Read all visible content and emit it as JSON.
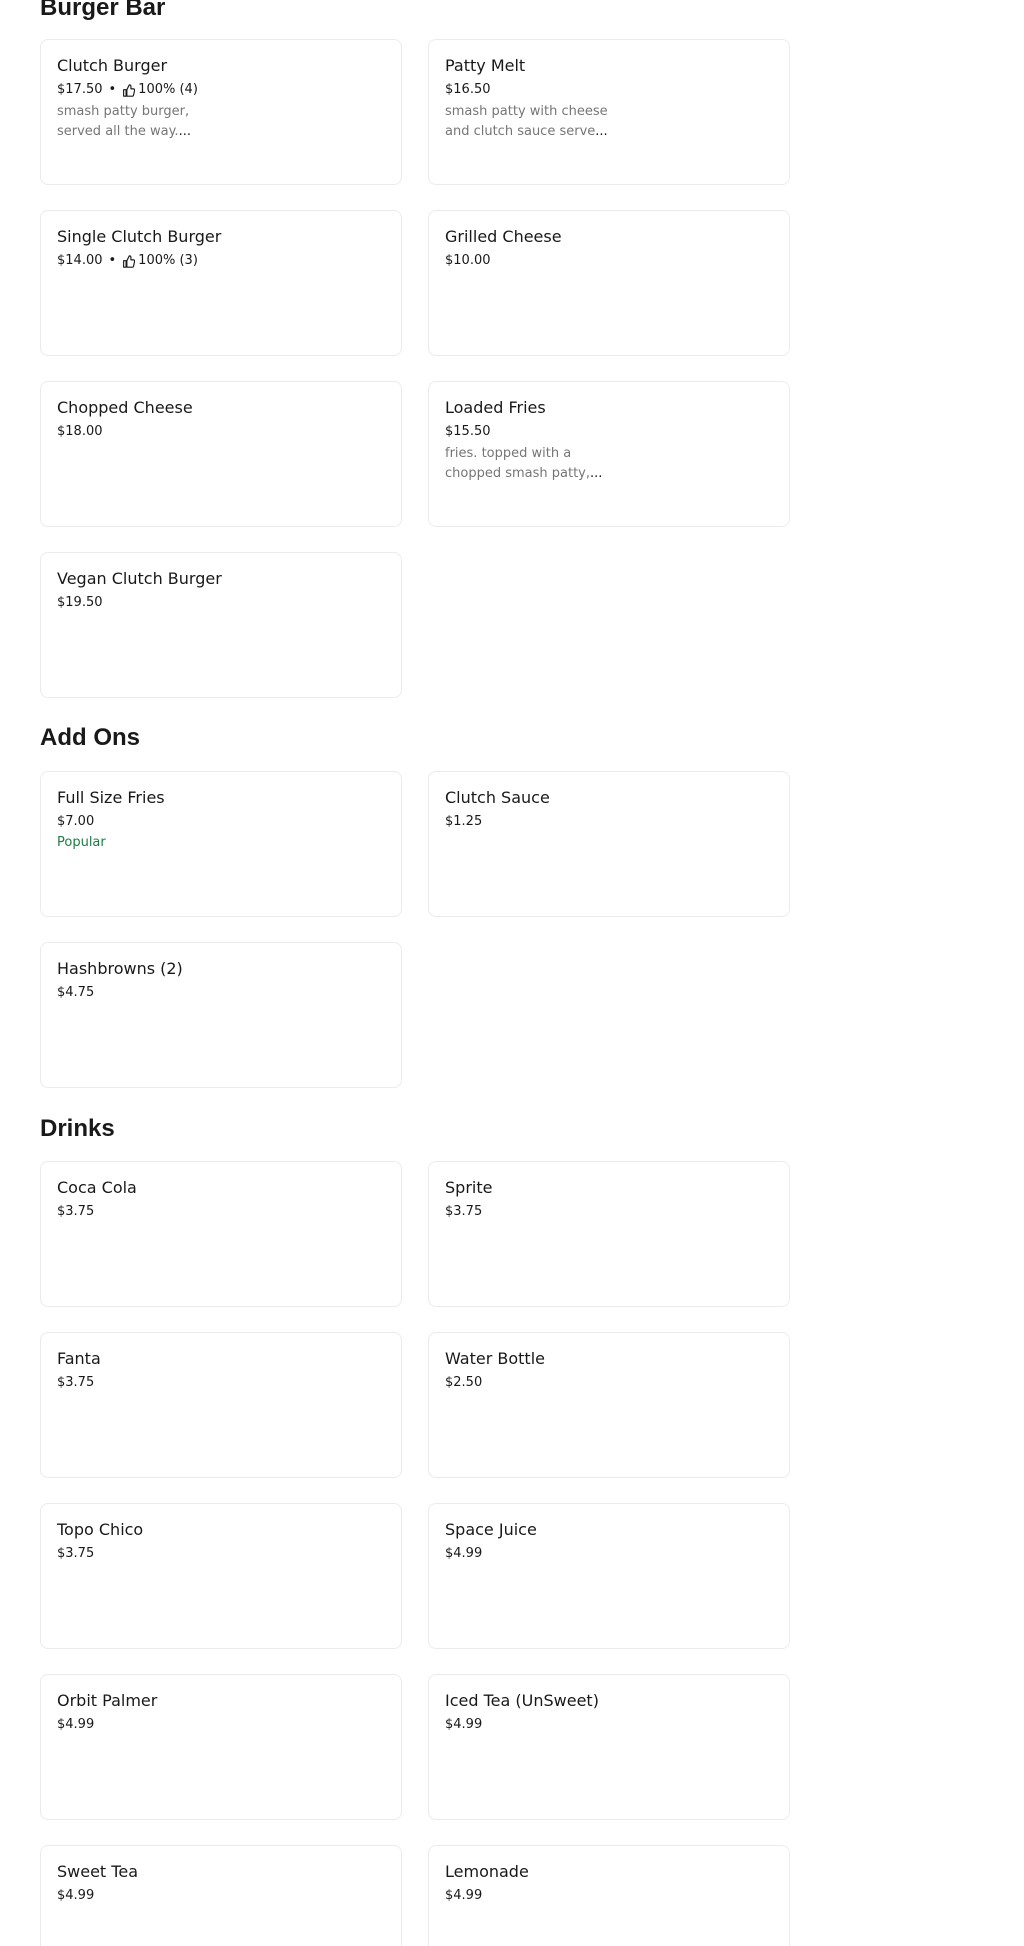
{
  "sections": [
    {
      "title": "Burger Bar",
      "items": [
        {
          "name": "Clutch Burger",
          "price": "$17.50",
          "rating": "100% (4)",
          "description_line1": "smash patty burger,",
          "description_line2": "served all the way.",
          "ellipsis": "..."
        },
        {
          "name": "Patty Melt",
          "price": "$16.50",
          "description_line1": "smash patty with cheese",
          "description_line2": "and clutch sauce serve",
          "ellipsis": "..."
        },
        {
          "name": "Single Clutch Burger",
          "price": "$14.00",
          "rating": "100% (3)"
        },
        {
          "name": "Grilled Cheese",
          "price": "$10.00"
        },
        {
          "name": "Chopped Cheese",
          "price": "$18.00"
        },
        {
          "name": "Loaded Fries",
          "price": "$15.50",
          "description_line1": "fries. topped with a",
          "description_line2": "chopped smash patty,",
          "ellipsis": "..."
        },
        {
          "name": "Vegan Clutch Burger",
          "price": "$19.50"
        }
      ]
    },
    {
      "title": "Add Ons",
      "items": [
        {
          "name": "Full Size Fries",
          "price": "$7.00",
          "badge": "Popular"
        },
        {
          "name": "Clutch Sauce",
          "price": "$1.25"
        },
        {
          "name": "Hashbrowns (2)",
          "price": "$4.75"
        }
      ]
    },
    {
      "title": "Drinks",
      "items": [
        {
          "name": "Coca Cola",
          "price": "$3.75"
        },
        {
          "name": "Sprite",
          "price": "$3.75"
        },
        {
          "name": "Fanta",
          "price": "$3.75"
        },
        {
          "name": "Water Bottle",
          "price": "$2.50"
        },
        {
          "name": "Topo Chico",
          "price": "$3.75"
        },
        {
          "name": "Space Juice",
          "price": "$4.99"
        },
        {
          "name": "Orbit Palmer",
          "price": "$4.99"
        },
        {
          "name": "Iced Tea (UnSweet)",
          "price": "$4.99"
        },
        {
          "name": "Sweet Tea",
          "price": "$4.99"
        },
        {
          "name": "Lemonade",
          "price": "$4.99"
        }
      ]
    }
  ],
  "rating_separator": "•",
  "icons": {
    "rating": "thumbs-up-icon"
  },
  "colors": {
    "badge": "#1d7a45",
    "description": "#767676",
    "card_border": "#ebebeb"
  }
}
